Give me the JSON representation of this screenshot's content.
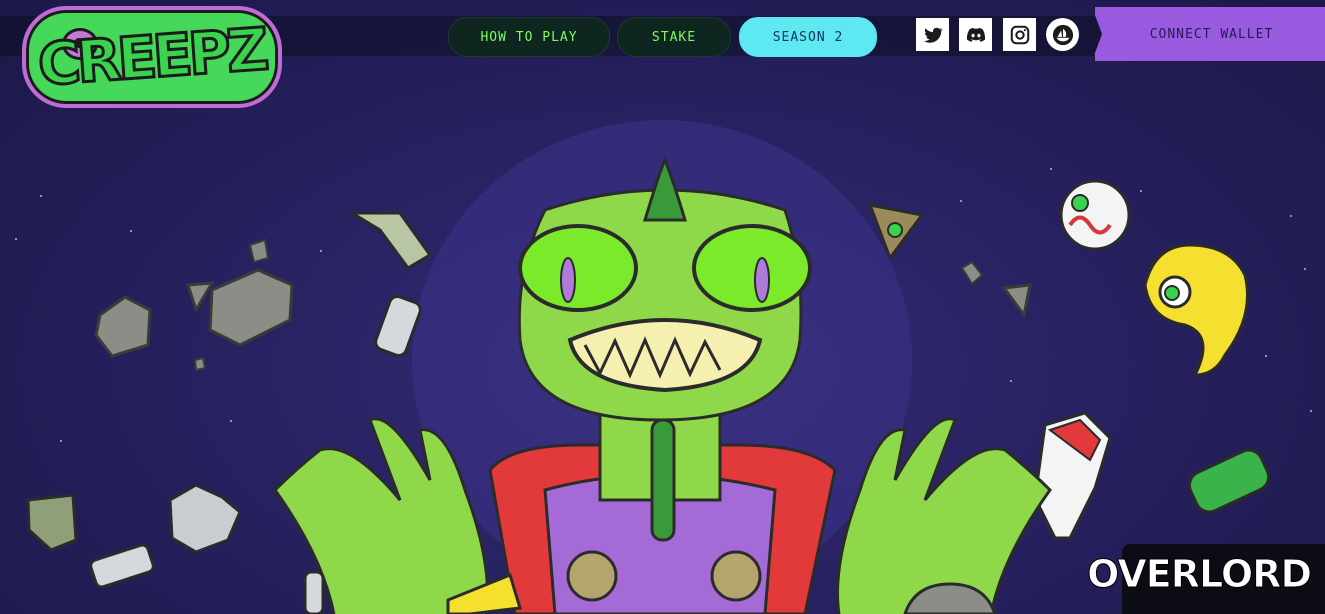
{
  "logo": {
    "text": "CREEPZ"
  },
  "nav": {
    "how_to_play": "HOW TO PLAY",
    "stake": "STAKE",
    "season": "SEASON 2"
  },
  "social": {
    "twitter_icon": "twitter-icon",
    "discord_icon": "discord-icon",
    "instagram_icon": "instagram-icon",
    "opensea_icon": "opensea-icon"
  },
  "wallet": {
    "label": "CONNECT WALLET"
  },
  "brand": {
    "text": "OVERLORD"
  },
  "colors": {
    "background": "#2a2466",
    "nav_text": "#7dff57",
    "nav_active": "#5ee8f2",
    "wallet": "#9a5ae0",
    "creature": "#8fd84a"
  }
}
